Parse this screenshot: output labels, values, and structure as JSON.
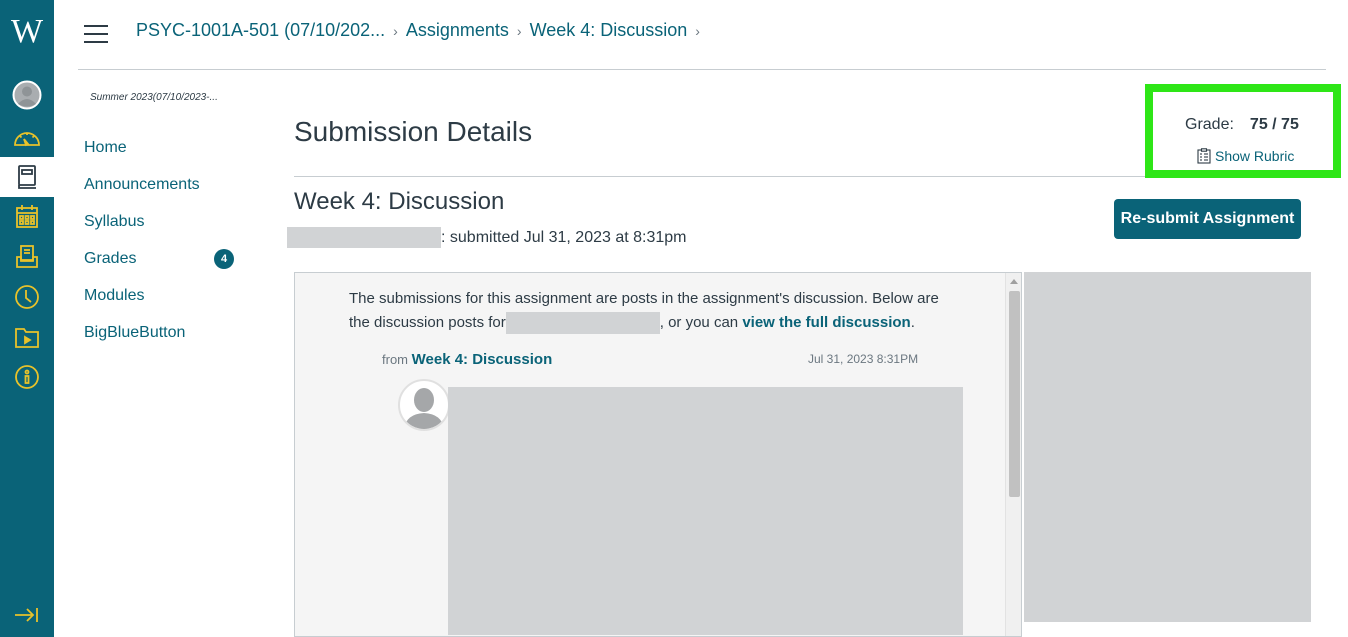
{
  "global_nav": {
    "logo": "W",
    "items": [
      {
        "name": "account",
        "icon": "avatar-icon"
      },
      {
        "name": "dashboard",
        "icon": "dashboard-icon"
      },
      {
        "name": "courses",
        "icon": "courses-icon",
        "active": true
      },
      {
        "name": "calendar",
        "icon": "calendar-icon"
      },
      {
        "name": "inbox",
        "icon": "inbox-icon"
      },
      {
        "name": "history",
        "icon": "clock-icon"
      },
      {
        "name": "studio",
        "icon": "folder-video-icon"
      },
      {
        "name": "help",
        "icon": "info-icon"
      }
    ],
    "collapse_icon": "collapse-nav-icon"
  },
  "header": {
    "breadcrumb": [
      {
        "label": "PSYC-1001A-501 (07/10/202..."
      },
      {
        "label": "Assignments"
      },
      {
        "label": "Week 4: Discussion"
      }
    ]
  },
  "course_nav": {
    "term": "Summer 2023(07/10/2023-...",
    "items": [
      {
        "label": "Home"
      },
      {
        "label": "Announcements"
      },
      {
        "label": "Syllabus"
      },
      {
        "label": "Grades",
        "badge": "4"
      },
      {
        "label": "Modules"
      },
      {
        "label": "BigBlueButton"
      }
    ]
  },
  "main": {
    "page_title": "Submission Details",
    "assignment_title": "Week 4: Discussion",
    "submitted_text": ": submitted Jul 31, 2023 at 8:31pm",
    "grade": {
      "label": "Grade:",
      "value": "75 / 75",
      "rubric_link": "Show Rubric"
    },
    "resubmit_button": "Re-submit Assignment",
    "discussion": {
      "intro_part1": "The submissions for this assignment are posts in the assignment's discussion. Below are the discussion posts for",
      "intro_part2": ", or you can",
      "intro_link": "view the full discussion",
      "intro_end": ".",
      "from_label": "from",
      "from_link": "Week 4: Discussion",
      "post_date": "Jul 31, 2023 8:31PM"
    }
  },
  "colors": {
    "nav_bg": "#0a6378",
    "nav_icon": "#e8c22a",
    "link": "#0a6378",
    "highlight": "#2ee617",
    "redaction": "#d1d3d5"
  }
}
